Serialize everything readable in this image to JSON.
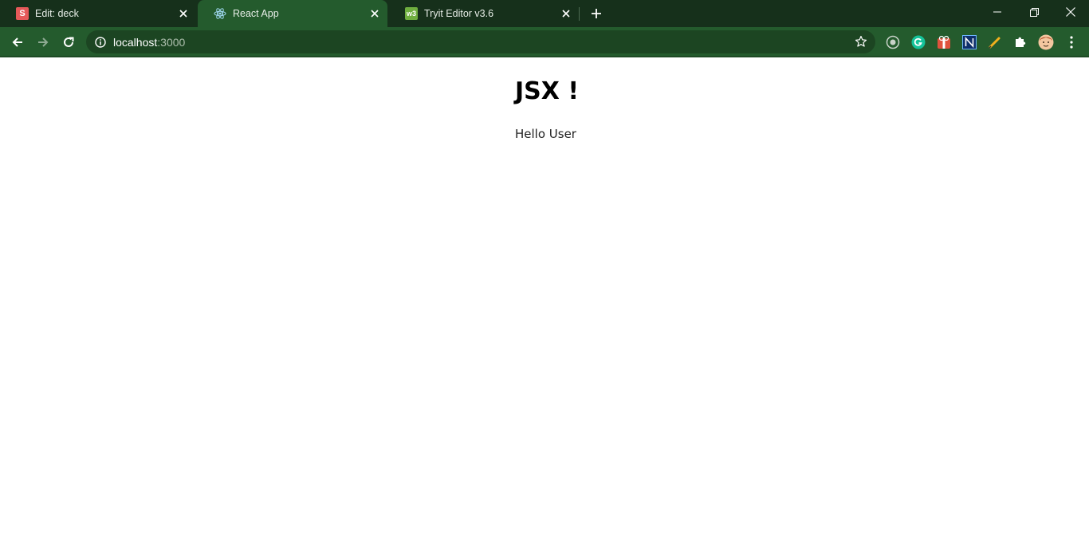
{
  "browser": {
    "tabs": [
      {
        "title": "Edit: deck",
        "favicon": "slides-s-icon",
        "active": false
      },
      {
        "title": "React App",
        "favicon": "react-atom-icon",
        "active": true
      },
      {
        "title": "Tryit Editor v3.6",
        "favicon": "w3schools-icon",
        "active": false
      }
    ],
    "favicon_letters": {
      "slides": "S",
      "w3": "w3"
    },
    "address_bar": {
      "host": "localhost",
      "port": ":3000"
    },
    "extensions": [
      "circle-target-icon",
      "grammarly-icon",
      "red-gift-icon",
      "n-extension-icon",
      "pencil-icon",
      "puzzle-piece-icon",
      "profile-avatar-icon",
      "more-menu-icon"
    ],
    "colors": {
      "frame": "#16301b",
      "toolbar": "#245b2d",
      "omnibox": "#1c4522"
    }
  },
  "page": {
    "heading": "JSX !",
    "paragraph": "Hello User"
  }
}
